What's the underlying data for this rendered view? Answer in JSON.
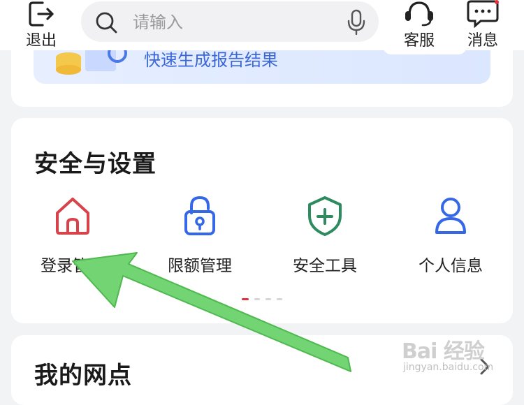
{
  "header": {
    "logout_label": "退出",
    "search_placeholder": "请输入",
    "service_label": "客服",
    "message_label": "消息"
  },
  "banner": {
    "text": "快速生成报告结果"
  },
  "security": {
    "title": "安全与设置",
    "items": [
      {
        "label": "登录管理",
        "icon": "home-icon",
        "color": "#d8434b"
      },
      {
        "label": "限额管理",
        "icon": "lock-icon",
        "color": "#3568e8"
      },
      {
        "label": "安全工具",
        "icon": "shield-plus-icon",
        "color": "#2e8b60"
      },
      {
        "label": "个人信息",
        "icon": "user-icon",
        "color": "#3568e8"
      }
    ],
    "page_indicator": {
      "pages": 4,
      "active": 0
    }
  },
  "branch": {
    "title": "我的网点"
  },
  "watermark": {
    "main": "Bai 经验",
    "sub": "jingyan.baidu.com"
  },
  "annotation": {
    "arrow_color": "#72d472"
  },
  "colors": {
    "accent_red": "#e0323c",
    "page_bg": "#f2f3f5"
  }
}
